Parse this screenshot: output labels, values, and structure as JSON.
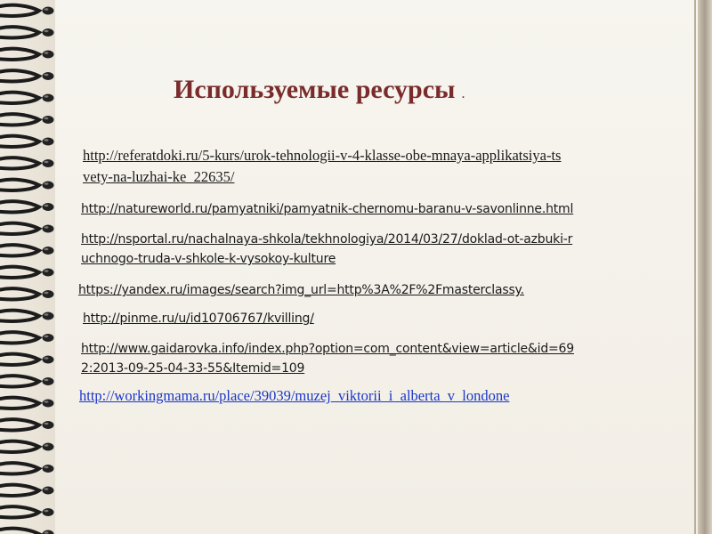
{
  "slide": {
    "title": "Используемые ресурсы",
    "title_suffix": ".",
    "links": [
      {
        "line1": "http://referatdoki.ru/5-kurs/urok-tehnologii-v-4-klasse-obe-mnaya-applikatsiya-ts",
        "line2": "vety-na-luzhai-ke_22635/"
      },
      {
        "line1": "http://natureworld.ru/pamyatniki/pamyatnik-chernomu-baranu-v-savonlinne.html"
      },
      {
        "line1": "http://nsportal.ru/nachalnaya-shkola/tekhnologiya/2014/03/27/doklad-ot-azbuki-r",
        "line2": "uchnogo-truda-v-shkole-k-vysokoy-kulture"
      },
      {
        "line1": "https://yandex.ru/images/search?img_url=http%3A%2F%2Fmasterclassy."
      },
      {
        "line1": "http://pinme.ru/u/id10706767/kvilling/"
      },
      {
        "line1": "http://www.gaidarovka.info/index.php?option=com_content&view=article&id=69",
        "line2": "2:2013-09-25-04-33-55&Itemid=109"
      },
      {
        "line1": "http://workingmama.ru/place/39039/muzej_viktorii_i_alberta_v_londone"
      }
    ],
    "colors": {
      "title": "#7a2c2c",
      "link_default": "#1a1a1a",
      "link_blue": "#1a36c8"
    }
  }
}
